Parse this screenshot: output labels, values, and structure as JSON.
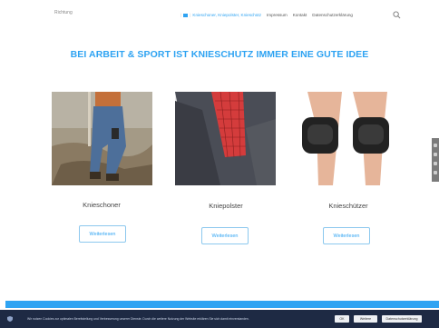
{
  "header": {
    "logo_text": "Richtung",
    "nav": {
      "active": "Knieschoner, Kniepolster, Knieschütz",
      "items": [
        "Impressum",
        "Kontakt",
        "Datenschutzerklärung"
      ]
    }
  },
  "hero": {
    "title": "BEI ARBEIT & SPORT IST KNIESCHUTZ IMMER EINE GUTE IDEE"
  },
  "cards": [
    {
      "title": "Knieschoner",
      "button": "Weiterlesen"
    },
    {
      "title": "Kniepolster",
      "button": "Weiterlesen"
    },
    {
      "title": "Knieschützer",
      "button": "Weiterlesen"
    }
  ],
  "cookie": {
    "text": "Wir nutzen Cookies zur optimalen Bereitstellung und Verbesserung unserer Dienste. Durch die weitere Nutzung der Website erklären Sie sich damit einverstanden.",
    "ok": "OK",
    "more": "Weitere",
    "privacy": "Datenschutzerklärung"
  },
  "colors": {
    "accent": "#2ea3f2",
    "cookie_bg": "#1e2a44"
  }
}
